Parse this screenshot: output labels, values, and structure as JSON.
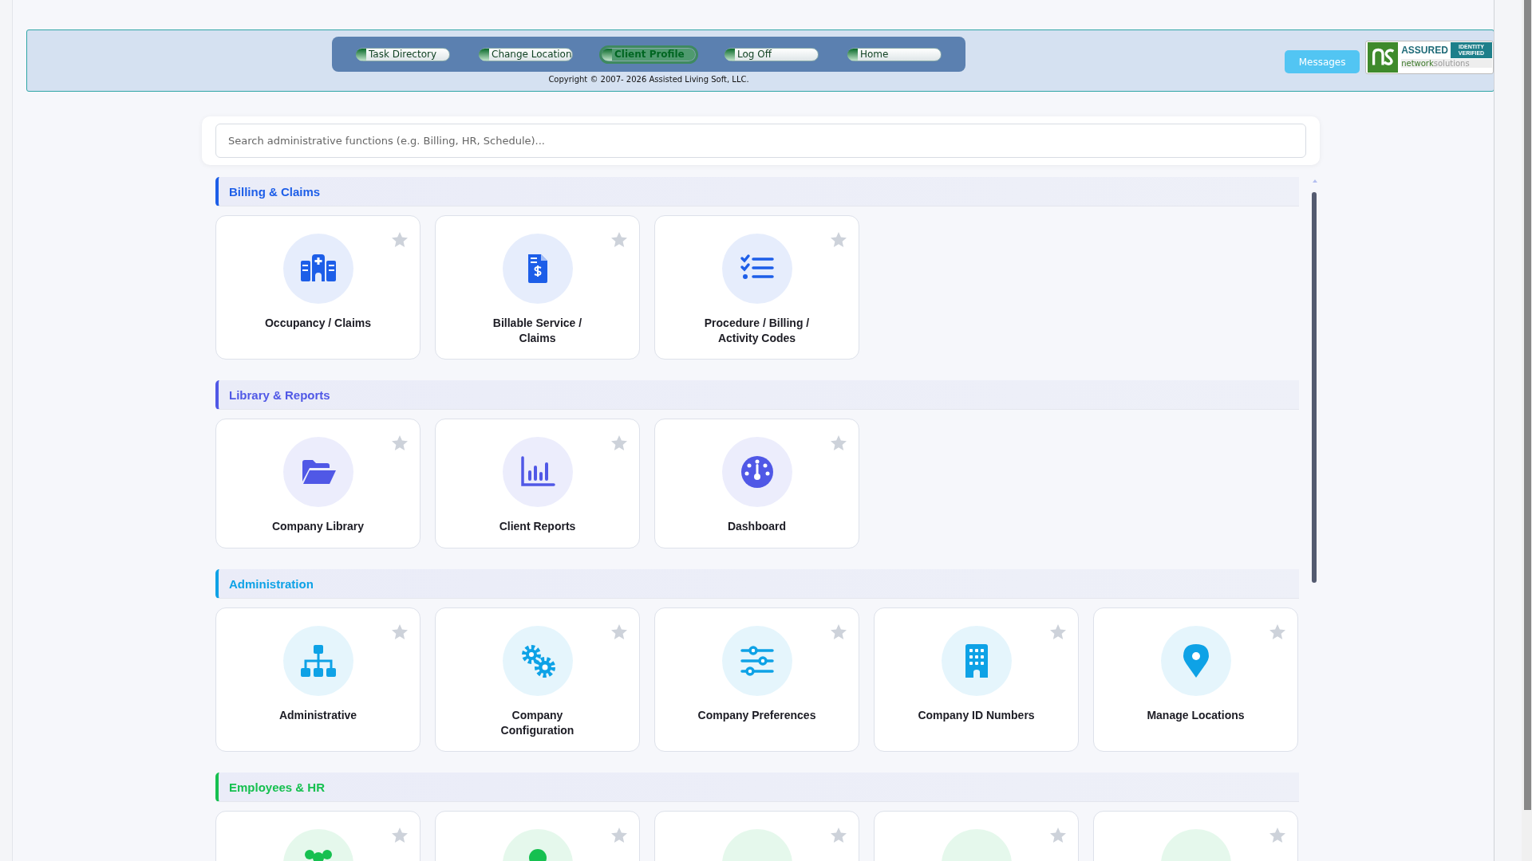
{
  "nav": [
    {
      "label": "Task Directory",
      "selected": false
    },
    {
      "label": "Change Location",
      "selected": false
    },
    {
      "label": "Client Profile",
      "selected": true
    },
    {
      "label": "Log Off",
      "selected": false
    },
    {
      "label": "Home",
      "selected": false
    }
  ],
  "copyright": "Copyright © 2007- 2026 Assisted Living Soft, LLC.",
  "messages_button": "Messages",
  "seal": {
    "assured": "ASSURED",
    "verified": "IDENTITY VERIFIED",
    "brand_bold": "network",
    "brand_light": "solutions"
  },
  "search": {
    "placeholder": "Search administrative functions (e.g. Billing, HR, Schedule)..."
  },
  "sections": [
    {
      "title": "Billing & Claims",
      "color": "#1d5ee8",
      "cards": [
        {
          "label": "Occupancy / Claims",
          "kind": "hospital",
          "favorite": false
        },
        {
          "label": "Billable Service / Claims",
          "kind": "invoice",
          "favorite": false
        },
        {
          "label": "Procedure / Billing / Activity Codes",
          "kind": "checklist",
          "favorite": false
        }
      ]
    },
    {
      "title": "Library & Reports",
      "color": "#5058e6",
      "cards": [
        {
          "label": "Company Library",
          "kind": "folder",
          "favorite": false
        },
        {
          "label": "Client Reports",
          "kind": "chart",
          "favorite": false
        },
        {
          "label": "Dashboard",
          "kind": "gauge",
          "favorite": false
        }
      ]
    },
    {
      "title": "Administration",
      "color": "#0ea2e6",
      "cards": [
        {
          "label": "Administrative",
          "kind": "sitemap",
          "favorite": false
        },
        {
          "label": "Company Configuration",
          "kind": "gears",
          "favorite": false
        },
        {
          "label": "Company Preferences",
          "kind": "sliders",
          "favorite": false
        },
        {
          "label": "Company ID Numbers",
          "kind": "building",
          "favorite": false
        },
        {
          "label": "Manage Locations",
          "kind": "pin",
          "favorite": false
        }
      ]
    },
    {
      "title": "Employees & HR",
      "color": "#16c050",
      "cards": [
        {
          "kind": "users",
          "favorite": false
        },
        {
          "kind": "person",
          "favorite": false
        },
        {
          "favorite": false
        },
        {
          "favorite": false
        },
        {
          "favorite": false
        }
      ]
    }
  ]
}
